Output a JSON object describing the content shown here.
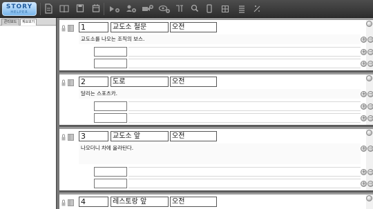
{
  "app": {
    "logo_text": "STORY",
    "logo_sub": "HELPER"
  },
  "toolbar": {
    "icons": [
      "document-icon",
      "book-icon",
      "save-icon",
      "calendar-icon",
      "add-character-icon",
      "add-person-icon",
      "add-camera-icon",
      "add-view-icon",
      "split-icon",
      "search-icon",
      "phone-icon",
      "grid-icon",
      "list-icon",
      "settings-icon"
    ]
  },
  "left_panel": {
    "tabs": [
      "콘티보드",
      "계요보기"
    ],
    "active_tab": 1
  },
  "scenes": [
    {
      "number": "1",
      "place": "교도소 철문",
      "time": "오전",
      "description": "교도소를 나오는 조직의 보스."
    },
    {
      "number": "2",
      "place": "도로",
      "time": "오전",
      "description": "달리는 스포츠카."
    },
    {
      "number": "3",
      "place": "교도소 앞",
      "time": "오전",
      "description": "나오더니 차에 올라탄다."
    },
    {
      "number": "4",
      "place": "레스토랑 앞",
      "time": "오전",
      "description": ""
    }
  ],
  "buttons": {
    "add": "+",
    "remove": "−"
  }
}
